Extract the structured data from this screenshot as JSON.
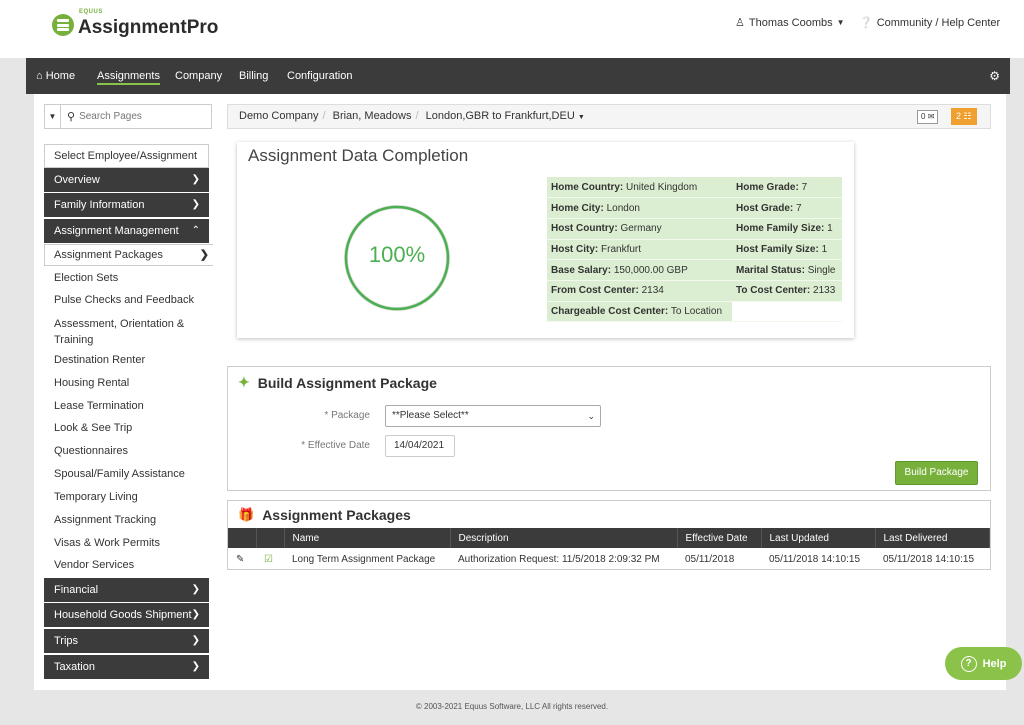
{
  "app": {
    "brand_small": "EQUUS",
    "brand": "AssignmentPro",
    "user_name": "Thomas Coombs",
    "community_link": "Community / Help Center"
  },
  "nav": {
    "items": [
      "Home",
      "Assignments",
      "Company",
      "Billing",
      "Configuration"
    ],
    "active": "Assignments"
  },
  "sidebar": {
    "search_placeholder": "Search Pages",
    "select_label": "Select Employee/Assignment",
    "headers_top": [
      "Overview",
      "Family Information",
      "Assignment Management"
    ],
    "links": [
      "Assignment Packages",
      "Election Sets",
      "Pulse Checks and Feedback",
      "Assessment, Orientation &",
      "Training",
      "Destination Renter",
      "Housing Rental",
      "Lease Termination",
      "Look & See Trip",
      "Questionnaires",
      "Spousal/Family Assistance",
      "Temporary Living",
      "Assignment Tracking",
      "Visas & Work Permits",
      "Vendor Services"
    ],
    "headers_bottom": [
      "Financial",
      "Household Goods Shipment",
      "Trips",
      "Taxation"
    ]
  },
  "breadcrumb": {
    "items": [
      "Demo Company",
      "Brian, Meadows",
      "London,GBR to Frankfurt,DEU"
    ],
    "mail_count": "0",
    "org_count": "2"
  },
  "completion": {
    "title": "Assignment Data Completion",
    "percent_label": "100%",
    "percent_value": 100,
    "fields": [
      {
        "label": "Home Country:",
        "value": "United Kingdom"
      },
      {
        "label": "Home Grade:",
        "value": "7"
      },
      {
        "label": "Home City:",
        "value": "London"
      },
      {
        "label": "Host Grade:",
        "value": "7"
      },
      {
        "label": "Host Country:",
        "value": "Germany"
      },
      {
        "label": "Home Family Size:",
        "value": "1"
      },
      {
        "label": "Host City:",
        "value": "Frankfurt"
      },
      {
        "label": "Host Family Size:",
        "value": "1"
      },
      {
        "label": "Base Salary:",
        "value": "150,000.00 GBP"
      },
      {
        "label": "Marital Status:",
        "value": "Single"
      },
      {
        "label": "From Cost Center:",
        "value": "2134"
      },
      {
        "label": "To Cost Center:",
        "value": "2133"
      },
      {
        "label": "Chargeable Cost Center:",
        "value": "To Location"
      }
    ]
  },
  "build": {
    "title": "Build Assignment Package",
    "package_label": "* Package",
    "package_value": "**Please Select**",
    "date_label": "* Effective Date",
    "date_value": "14/04/2021",
    "button": "Build Package"
  },
  "packages": {
    "title": "Assignment Packages",
    "columns": [
      "Name",
      "Description",
      "Effective Date",
      "Last Updated",
      "Last Delivered"
    ],
    "rows": [
      {
        "name": "Long Term Assignment Package",
        "description": "Authorization Request: 11/5/2018 2:09:32 PM",
        "effective": "05/11/2018",
        "updated": "05/11/2018 14:10:15",
        "delivered": "05/11/2018 14:10:15"
      }
    ]
  },
  "help_label": "Help",
  "footer": "© 2003-2021 Equus Software, LLC All rights reserved.",
  "colors": {
    "accent": "#77b13c",
    "nav_bg": "#3b3b3b",
    "warning": "#f0a030"
  }
}
